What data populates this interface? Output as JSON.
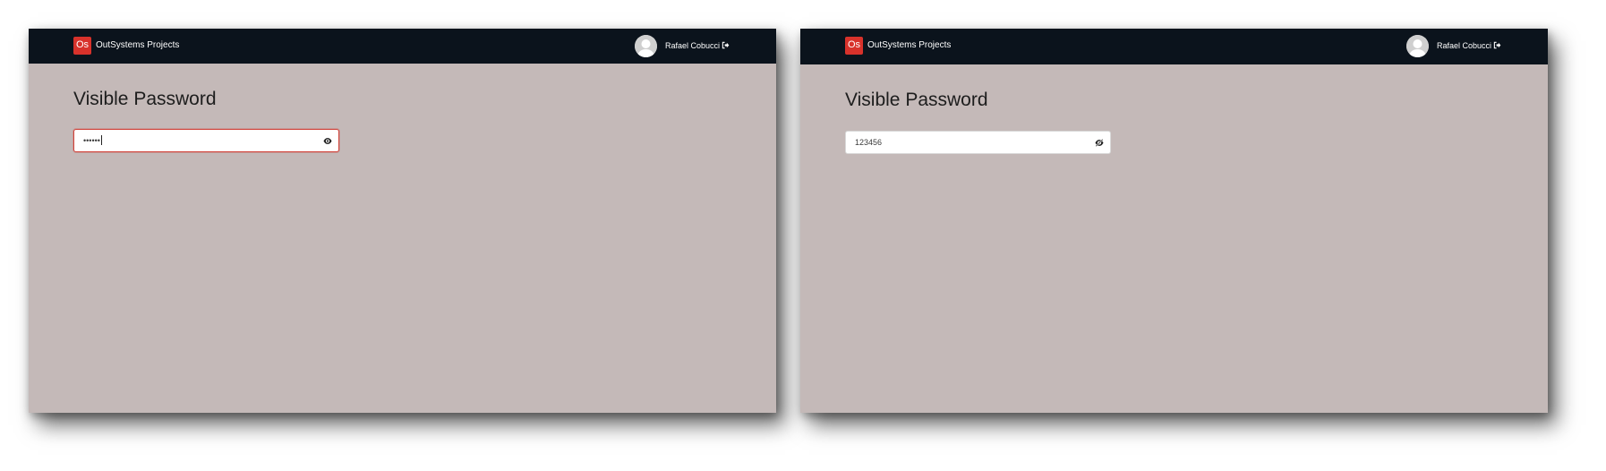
{
  "screens": [
    {
      "app_title": "OutSystems Projects",
      "logo_text": "Os",
      "user_name": "Rafael Cobucci",
      "page_title": "Visible Password",
      "password_field": {
        "value": "••••••",
        "state": "focused, masked",
        "toggle_icon": "eye-icon"
      }
    },
    {
      "app_title": "OutSystems Projects",
      "logo_text": "Os",
      "user_name": "Rafael Cobucci",
      "page_title": "Visible Password",
      "password_field": {
        "value": "123456",
        "state": "revealed",
        "toggle_icon": "eye-slash-icon"
      }
    }
  ],
  "colors": {
    "topbar": "#0b131c",
    "page_background": "#c4b9b8",
    "logo_accent": "#d8322b",
    "focus_border": "#d0443b"
  }
}
